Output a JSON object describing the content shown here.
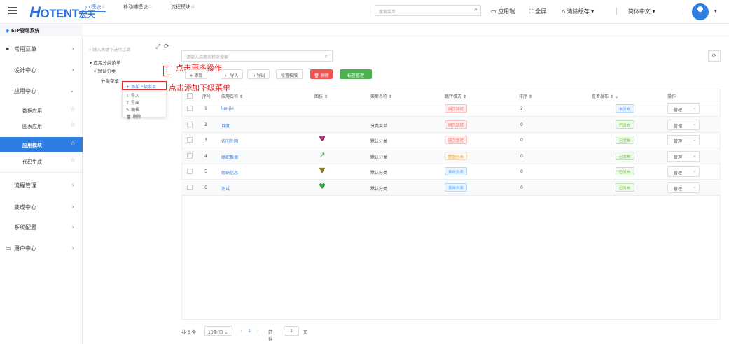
{
  "header": {
    "logo_main": "OTENT",
    "logo_h": "H",
    "logo_cn": "宏天",
    "search_placeholder": "搜索菜单",
    "links": [
      "应用端",
      "全屏",
      "清除缓存",
      "简体中文"
    ]
  },
  "sidebar": {
    "system": "EIP管理系统",
    "groups": [
      {
        "label": "常用菜单"
      },
      {
        "label": "设计中心"
      },
      {
        "label": "应用中心"
      },
      {
        "label": "流程管理"
      },
      {
        "label": "集成中心"
      },
      {
        "label": "系统配置"
      },
      {
        "label": "用户中心"
      }
    ],
    "sub_items": [
      "数据应用",
      "图表应用",
      "应用模块",
      "代码生成"
    ]
  },
  "tabs": [
    "pc模块☆",
    "移动端模块☆",
    "流程模块☆"
  ],
  "tree": {
    "filter_placeholder": "输入关键字进行过滤",
    "nodes": [
      "应用分类菜单",
      "默认分类",
      "分类菜单"
    ],
    "context_menu": [
      "添加下级菜单",
      "导入",
      "导出",
      "编辑",
      "删除"
    ]
  },
  "annotations": {
    "more_ops": "点击更多操作",
    "add_child": "点击添加下级菜单"
  },
  "panel": {
    "search_placeholder": "请输入应用名称来搜索",
    "buttons": [
      "+ 添加",
      "← 导入",
      "→ 导出",
      "设置权限",
      "删除",
      "标签管理"
    ]
  },
  "table": {
    "headers": [
      "序号",
      "应用名称",
      "图标",
      "菜单名称",
      "跳转模式",
      "排序",
      "是否发布",
      "操作"
    ],
    "rows": [
      {
        "no": "1",
        "name": "lianjie",
        "menu": "",
        "mode": "网页跳转",
        "mode_color": "red",
        "sort": "2",
        "pub": "未发布",
        "pub_color": "blue",
        "op": "管理",
        "icon": ""
      },
      {
        "no": "2",
        "name": "百度",
        "menu": "分类菜单",
        "mode": "网页跳转",
        "mode_color": "red",
        "sort": "0",
        "pub": "已发布",
        "pub_color": "green",
        "op": "管理",
        "icon": ""
      },
      {
        "no": "3",
        "name": "访问外网",
        "menu": "默认分类",
        "mode": "网页跳转",
        "mode_color": "red",
        "sort": "0",
        "pub": "已发布",
        "pub_color": "green",
        "op": "管理",
        "icon": "heart-icon"
      },
      {
        "no": "4",
        "name": "组织数据",
        "menu": "默认分类",
        "mode": "数据列表",
        "mode_color": "orange",
        "sort": "0",
        "pub": "已发布",
        "pub_color": "green",
        "op": "管理",
        "icon": "external-link-icon"
      },
      {
        "no": "5",
        "name": "组织信息",
        "menu": "默认分类",
        "mode": "表单列表",
        "mode_color": "blue",
        "sort": "0",
        "pub": "已发布",
        "pub_color": "green",
        "op": "管理",
        "icon": "filter-icon"
      },
      {
        "no": "6",
        "name": "测试",
        "menu": "默认分类",
        "mode": "表单列表",
        "mode_color": "blue",
        "sort": "0",
        "pub": "已发布",
        "pub_color": "green",
        "op": "管理",
        "icon": "heart-green-icon"
      }
    ]
  },
  "pagination": {
    "total": "共 6 条",
    "page_size": "10条/页",
    "current": "1",
    "goto_prefix": "前往",
    "goto_value": "1",
    "goto_suffix": "页"
  },
  "colors": {
    "accent": "#2e7de0",
    "annotation": "#e02020",
    "delete": "#ef5350",
    "tag_button": "#4caf50",
    "heart_purple": "#a0286f",
    "heart_green": "#2e9e3a",
    "filter_olive": "#8a7a1e",
    "link_green": "#2e9e3a"
  }
}
